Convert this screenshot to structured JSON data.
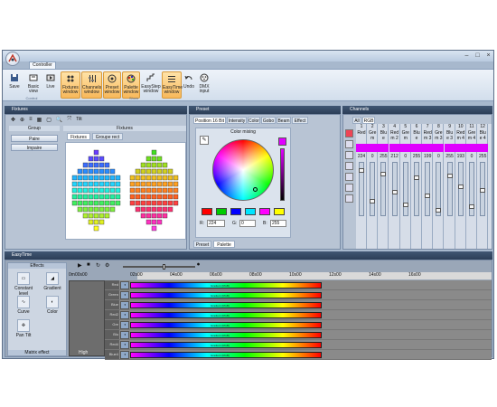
{
  "app": {
    "tab": "Controller"
  },
  "ribbon": {
    "buttons": [
      {
        "label": "Save",
        "icon": "save-icon"
      },
      {
        "label": "Basic view",
        "icon": "basic-view-icon"
      },
      {
        "label": "Live",
        "icon": "live-icon"
      },
      {
        "label": "Fixtures window",
        "icon": "fixtures-window-icon"
      },
      {
        "label": "Channels window",
        "icon": "channels-window-icon"
      },
      {
        "label": "Preset window",
        "icon": "preset-window-icon"
      },
      {
        "label": "Palette window",
        "icon": "palette-window-icon"
      },
      {
        "label": "EasyStep window",
        "icon": "easystep-window-icon"
      },
      {
        "label": "EasyTime window",
        "icon": "easytime-window-icon"
      },
      {
        "label": "Undo",
        "icon": "undo-icon"
      },
      {
        "label": "DMX input",
        "icon": "dmx-input-icon"
      }
    ],
    "groups": [
      "Control",
      "Show"
    ]
  },
  "fixtures": {
    "title": "Fixtures",
    "tilt": "Tilt",
    "group_header": "Group",
    "groups": [
      "Paire",
      "Impaire"
    ],
    "area_header": "Fixtures",
    "tabs": [
      "Fixtures",
      "Groupe rect"
    ]
  },
  "preset": {
    "title": "Preset",
    "tabs": [
      "Position 16 Bit",
      "Intensity",
      "Color",
      "Gobo",
      "Beam",
      "Effect"
    ],
    "color_mixing": "Color mixing",
    "swatches": [
      "#ff0000",
      "#00cc00",
      "#0000ff",
      "#00e5ff",
      "#ff00ff",
      "#ffff00"
    ],
    "selected_color": "#e000ff",
    "inputs": [
      {
        "label": "R:",
        "value": "224"
      },
      {
        "label": "G:",
        "value": "0"
      },
      {
        "label": "B:",
        "value": "255"
      }
    ],
    "bottom_tabs": [
      "Preset",
      "Palette"
    ]
  },
  "channels": {
    "title": "Channels",
    "tabs": [
      "All",
      "RGB"
    ],
    "numbers": [
      "1",
      "2",
      "3",
      "4",
      "5",
      "6",
      "7",
      "8",
      "9",
      "10",
      "11",
      "12"
    ],
    "names": [
      "Red",
      "Gre",
      "Blu",
      "Red",
      "Gre",
      "Blu",
      "Red",
      "Gre",
      "Blu",
      "Red",
      "Gre",
      "Blu"
    ],
    "subnames": [
      "",
      "m",
      "e",
      "m 2",
      "m",
      "e",
      "m 3",
      "m 3",
      "e 3",
      "m 4",
      "m 4",
      "e 4"
    ],
    "values": [
      "224",
      "0",
      "255",
      "212",
      "0",
      "255",
      "199",
      "0",
      "255",
      "193",
      "0",
      "255"
    ]
  },
  "easytime": {
    "title": "EasyTime",
    "effects_header": "Effects",
    "effects": [
      "Constant level",
      "Gradient",
      "Curve",
      "Color",
      "Pan Tilt"
    ],
    "matrix": "Matrix effect",
    "time_label": "0m00s00",
    "ticks": [
      "0m00s00",
      "02s00",
      "04s00",
      "06s00",
      "08s00",
      "10s00",
      "12s00",
      "14s00",
      "16s00"
    ],
    "tracks": [
      "Red",
      "Green",
      "Blue",
      "Red2",
      "Gre",
      "Blu",
      "Red4",
      "Blue4"
    ],
    "bar_label": "Gradient (RGB)",
    "track_label": "High"
  }
}
